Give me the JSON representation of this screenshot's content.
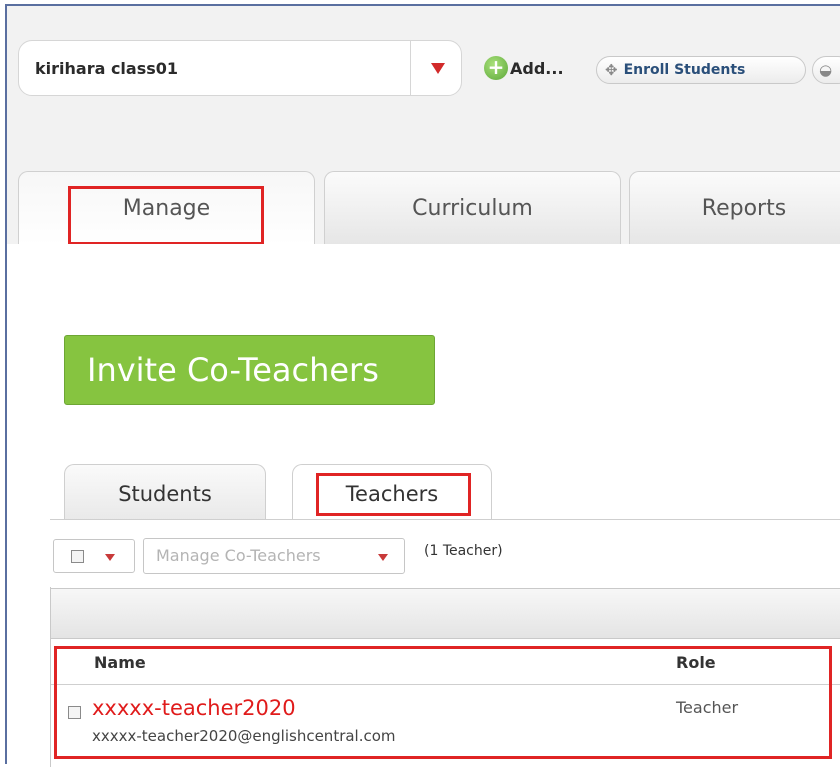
{
  "header": {
    "class_name": "kirihara class01",
    "add_label": "Add...",
    "enroll_label": "Enroll Students"
  },
  "main_tabs": [
    {
      "label": "Manage",
      "active": true
    },
    {
      "label": "Curriculum",
      "active": false
    },
    {
      "label": "Reports",
      "active": false
    }
  ],
  "invite_button": "Invite Co-Teachers",
  "sub_tabs": [
    {
      "label": "Students",
      "active": false
    },
    {
      "label": "Teachers",
      "active": true
    }
  ],
  "toolbar": {
    "manage_dropdown": "Manage Co-Teachers",
    "teacher_count": "(1 Teacher)"
  },
  "table": {
    "columns": [
      "Name",
      "Role"
    ],
    "rows": [
      {
        "name": "xxxxx-teacher2020",
        "email": "xxxxx-teacher2020@englishcentral.com",
        "role": "Teacher"
      }
    ]
  },
  "colors": {
    "accent_green": "#86c440",
    "highlight_red": "#e02424",
    "caret_red": "#d22a2a",
    "link_blue": "#2a4f7a"
  },
  "icons": [
    "dropdown-caret-icon",
    "add-plus-icon",
    "enroll-move-icon",
    "graduation-cap-icon",
    "checkbox-icon"
  ]
}
